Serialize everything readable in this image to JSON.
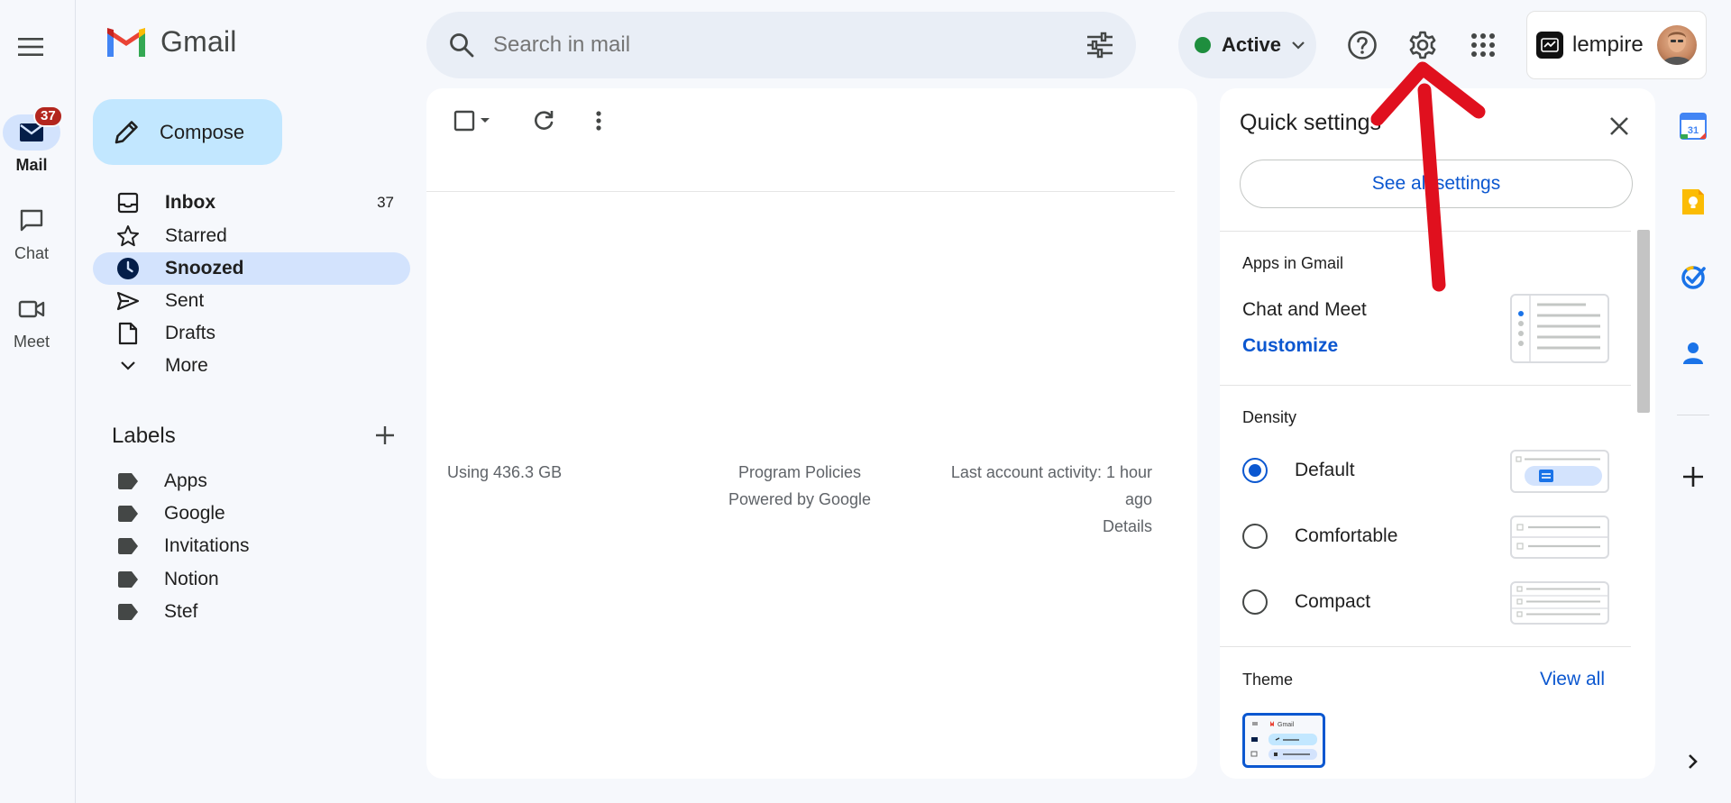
{
  "rail": {
    "mail_label": "Mail",
    "mail_badge": "37",
    "chat_label": "Chat",
    "meet_label": "Meet"
  },
  "header": {
    "app_name": "Gmail",
    "search_placeholder": "Search in mail",
    "status": "Active",
    "org_name": "lempire"
  },
  "compose": {
    "label": "Compose"
  },
  "nav": {
    "items": [
      {
        "label": "Inbox",
        "count": "37"
      },
      {
        "label": "Starred",
        "count": ""
      },
      {
        "label": "Snoozed",
        "count": ""
      },
      {
        "label": "Sent",
        "count": ""
      },
      {
        "label": "Drafts",
        "count": ""
      },
      {
        "label": "More",
        "count": ""
      }
    ]
  },
  "labels": {
    "title": "Labels",
    "items": [
      "Apps",
      "Google",
      "Invitations",
      "Notion",
      "Stef"
    ]
  },
  "footer": {
    "storage": "Using 436.3 GB",
    "policies": "Program Policies",
    "powered": "Powered by Google",
    "activity_line1": "Last account activity: 1 hour",
    "activity_line2": "ago",
    "details": "Details"
  },
  "quick_settings": {
    "title": "Quick settings",
    "see_all": "See all settings",
    "apps_section": "Apps in Gmail",
    "apps_item": "Chat and Meet",
    "customize": "Customize",
    "density_section": "Density",
    "density_options": [
      "Default",
      "Comfortable",
      "Compact"
    ],
    "density_selected": "Default",
    "theme_section": "Theme",
    "view_all": "View all",
    "theme_thumb_label": "Gmail"
  },
  "colors": {
    "accent": "#0b57d0",
    "compose_bg": "#c2e7ff",
    "active_nav": "#d3e3fd",
    "badge": "#b3261e",
    "status": "#1e8e3e",
    "arrow": "#e0101e"
  }
}
